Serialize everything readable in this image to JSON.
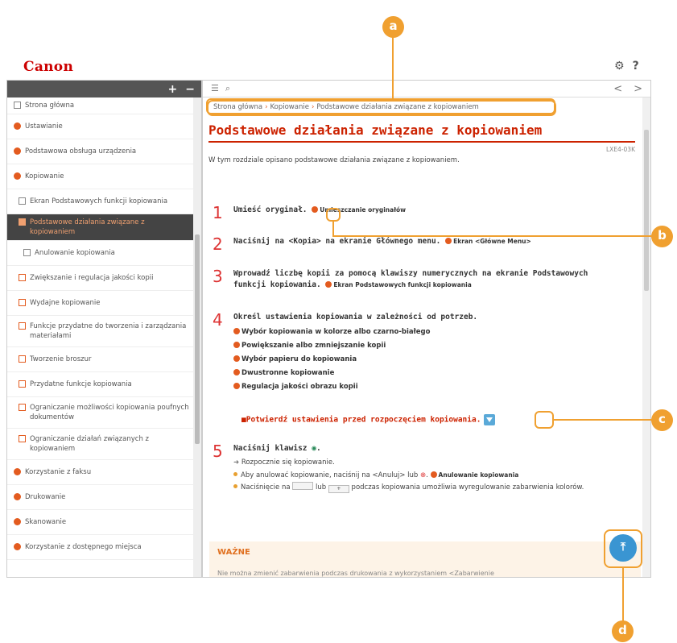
{
  "app": {
    "logo": "Canon",
    "settings_icon": "gear-icon",
    "help_label": "?"
  },
  "sidebar": {
    "toolbar": {
      "expand_label": "+",
      "collapse_label": "−"
    },
    "items": [
      {
        "label": "Strona główna",
        "icon": "doc"
      },
      {
        "label": "Ustawianie",
        "icon": "dot"
      },
      {
        "label": "Podstawowa obsługa urządzenia",
        "icon": "dot"
      },
      {
        "label": "Kopiowanie",
        "icon": "dot"
      },
      {
        "label": "Ekran Podstawowych funkcji kopiowania",
        "icon": "doc"
      },
      {
        "label": "Podstawowe działania związane z kopiowaniem",
        "icon": "doc"
      },
      {
        "label": "Anulowanie kopiowania",
        "icon": "doc"
      },
      {
        "label": "Zwiększanie i regulacja jakości kopii",
        "icon": "plus"
      },
      {
        "label": "Wydajne kopiowanie",
        "icon": "plus"
      },
      {
        "label": "Funkcje przydatne do tworzenia i zarządzania materiałami",
        "icon": "plus"
      },
      {
        "label": "Tworzenie broszur",
        "icon": "plus"
      },
      {
        "label": "Przydatne funkcje kopiowania",
        "icon": "plus"
      },
      {
        "label": "Ograniczanie możliwości kopiowania poufnych dokumentów",
        "icon": "plus"
      },
      {
        "label": "Ograniczanie działań związanych z kopiowaniem",
        "icon": "plus"
      },
      {
        "label": "Korzystanie z faksu",
        "icon": "dot"
      },
      {
        "label": "Drukowanie",
        "icon": "dot"
      },
      {
        "label": "Skanowanie",
        "icon": "dot"
      },
      {
        "label": "Korzystanie z dostępnego miejsca",
        "icon": "dot"
      }
    ]
  },
  "main": {
    "toolbar": {
      "prev_label": "<",
      "next_label": ">"
    },
    "breadcrumb": [
      "Strona główna",
      "Kopiowanie",
      "Podstawowe działania związane z kopiowaniem"
    ],
    "title": "Podstawowe działania związane z kopiowaniem",
    "code": "LXE4-03K",
    "intro": "W tym rozdziale opisano podstawowe działania związane z kopiowaniem.",
    "steps": [
      {
        "num": "1",
        "text": "Umieść oryginał.",
        "link": "Umieszczanie oryginałów"
      },
      {
        "num": "2",
        "text": "Naciśnij na <Kopia> na ekranie Głównego menu.",
        "link": "Ekran <Główne Menu>"
      },
      {
        "num": "3",
        "text": "Wprowadź liczbę kopii za pomocą klawiszy numerycznych na ekranie Podstawowych funkcji kopiowania.",
        "link": "Ekran Podstawowych funkcji kopiowania"
      },
      {
        "num": "4",
        "text": "Określ ustawienia kopiowania w zależności od potrzeb.",
        "links": [
          "Wybór kopiowania w kolorze albo czarno-białego",
          "Powiększanie albo zmniejszanie kopii",
          "Wybór papieru do kopiowania",
          "Dwustronne kopiowanie",
          "Regulacja jakości obrazu kopii"
        ]
      },
      {
        "num": "5",
        "text": "Naciśnij klawisz",
        "bullets": [
          "Rozpocznie się kopiowanie.",
          "Aby anulować kopiowanie, naciśnij na <Anuluj> lub",
          "Anulowanie kopiowania",
          "Naciśnięcie na",
          "lub",
          "podczas kopiowania umożliwia wyregulowanie zabarwienia kolorów."
        ]
      }
    ],
    "warning": "Potwierdź ustawienia przed rozpoczęciem kopiowania.",
    "important": {
      "title": "WAŻNE",
      "text": "Nie można zmienić zabarwienia podczas drukowania z wykorzystaniem <Zabarwienie"
    }
  },
  "annotations": [
    "a",
    "b",
    "c",
    "d"
  ],
  "colors": {
    "accent": "#f0a030",
    "title_red": "#cc2200",
    "brand_red": "#cc0000",
    "top_button": "#3a95d2"
  }
}
